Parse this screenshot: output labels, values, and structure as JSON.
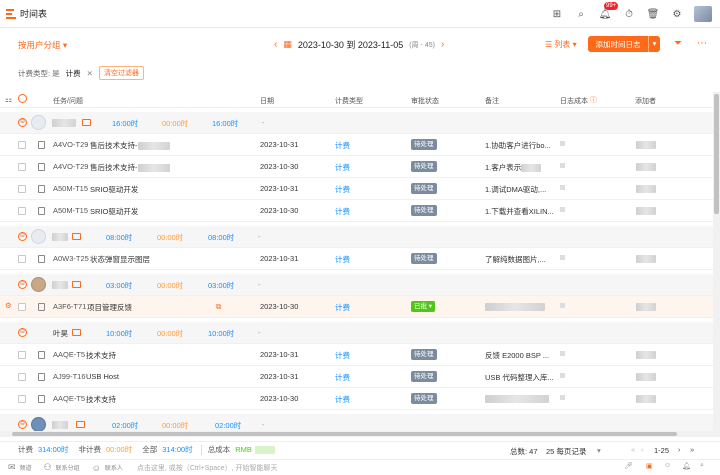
{
  "app": {
    "title": "时间表",
    "notification_count": "99+"
  },
  "toolbar": {
    "group_by": "按用户分组 ▾",
    "date_range": "2023-10-30 到 2023-11-05",
    "week": "(周 - 45)",
    "list_view": "列表 ▾",
    "add_button": "添加时间日志",
    "add_dropdown": "▾"
  },
  "filters": {
    "label": "计费类型: 是",
    "value": "计费",
    "clear": "清空过滤器"
  },
  "columns": {
    "task": "任务/问题",
    "date": "日期",
    "billing_type": "计费类型",
    "approval": "审批状态",
    "notes": "备注",
    "log_cost": "日志成本",
    "added_by": "添加者"
  },
  "groups": [
    {
      "total": "16:00时",
      "nonbill": "00:00时",
      "billable": "16:00时",
      "dash": "-"
    },
    {
      "total": "08:00时",
      "nonbill": "00:00时",
      "billable": "08:00时",
      "dash": "-"
    },
    {
      "total": "03:00时",
      "nonbill": "00:00时",
      "billable": "03:00时",
      "dash": "-"
    },
    {
      "name": "叶昊",
      "total": "10:00时",
      "nonbill": "00:00时",
      "billable": "10:00时",
      "dash": "-"
    },
    {
      "total": "02:00时",
      "nonbill": "00:00时",
      "billable": "02:00时",
      "dash": "-"
    }
  ],
  "rows": [
    {
      "id": "A4VO-T29",
      "task": "售后技术支持-",
      "date": "2023-10-31",
      "billing": "计费",
      "status": "待处理",
      "note": "1.协助客户进行bo..."
    },
    {
      "id": "A4VO-T29",
      "task": "售后技术支持-",
      "date": "2023-10-30",
      "billing": "计费",
      "status": "待处理",
      "note": "1.客户表示"
    },
    {
      "id": "A50M-T15",
      "task": "SRIO驱动开发",
      "date": "2023-10-31",
      "billing": "计费",
      "status": "待处理",
      "note": "1.调试DMA驱动,..."
    },
    {
      "id": "A50M-T15",
      "task": "SRIO驱动开发",
      "date": "2023-10-30",
      "billing": "计费",
      "status": "待处理",
      "note": "1.下载并查看XILIN..."
    },
    {
      "id": "A0W3-T25",
      "task": "状态弹窗显示图层",
      "date": "2023-10-31",
      "billing": "计费",
      "status": "待处理",
      "note": "了解纯数据图片,..."
    },
    {
      "id": "A3F6-T71",
      "task": "项目管理反馈",
      "date": "2023-10-30",
      "billing": "计费",
      "status": "已批 ▾",
      "note": ""
    },
    {
      "id": "AAQE-T5",
      "task": "技术支持",
      "date": "2023-10-31",
      "billing": "计费",
      "status": "待处理",
      "note": "反馈 E2000 BSP ..."
    },
    {
      "id": "AJ99-T16",
      "task": "USB Host",
      "date": "2023-10-31",
      "billing": "计费",
      "status": "待处理",
      "note": "USB 代码整理入库..."
    },
    {
      "id": "AAQE-T5",
      "task": "技术支持",
      "date": "2023-10-30",
      "billing": "计费",
      "status": "待处理",
      "note": ""
    }
  ],
  "footer": {
    "billable_label": "计费",
    "billable_value": "314:00时",
    "nonbill_label": "非计费",
    "nonbill_value": "00:00时",
    "all_label": "全部",
    "all_value": "314:00时",
    "cost_label": "总成本",
    "cost_value": "RMB",
    "total_count": "总数: 47",
    "page_size": "25 每页记录",
    "range": "1-25"
  },
  "bottom": {
    "hint": "点击这里, 或按（Ctrl+Space）, 开始智能聊天",
    "tab1": "频道",
    "tab2": "联系分组",
    "tab3": "联系人"
  }
}
